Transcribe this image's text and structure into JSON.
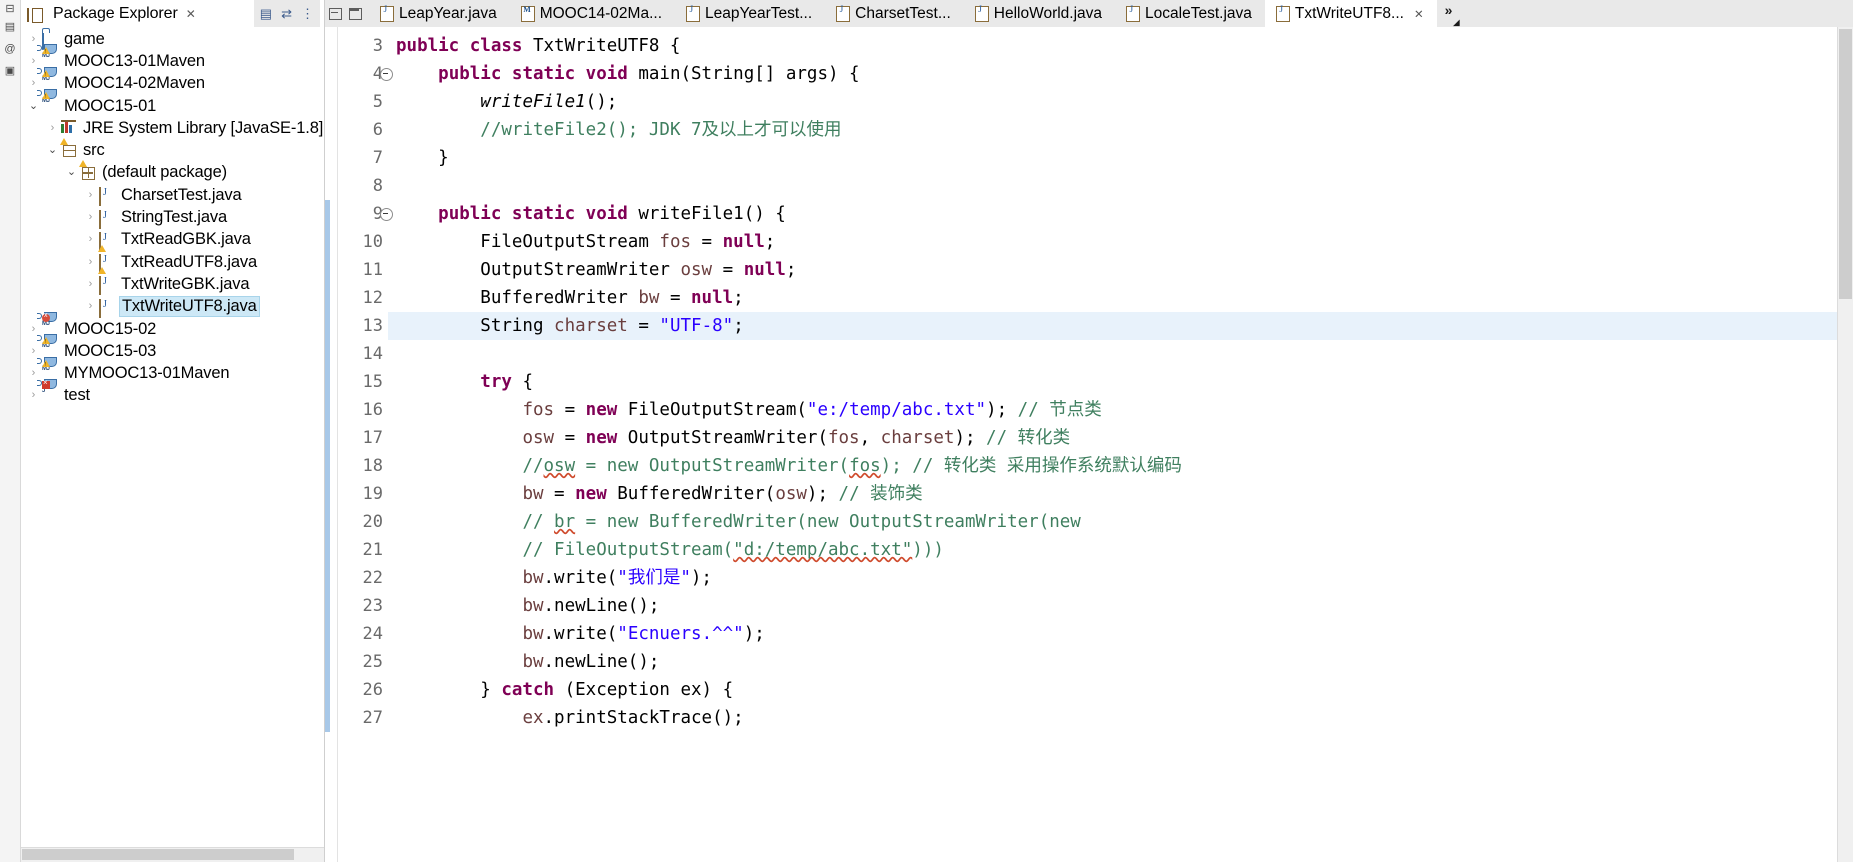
{
  "rail": {
    "icons": [
      "restore-view-icon",
      "package-explorer-icon",
      "annotations-icon",
      "snippets-icon"
    ]
  },
  "explorer": {
    "tab_title": "Package Explorer",
    "tab_close": "✕",
    "toolbar": [
      "collapse-all-icon",
      "link-with-editor-icon",
      "view-menu-icon"
    ],
    "tree": [
      {
        "indent": 0,
        "twisty": "collapsed",
        "icon": "folder",
        "label": "game"
      },
      {
        "indent": 0,
        "twisty": "collapsed",
        "icon": "project-warn",
        "label": "MOOC13-01Maven"
      },
      {
        "indent": 0,
        "twisty": "collapsed",
        "icon": "project-warn",
        "label": "MOOC14-02Maven"
      },
      {
        "indent": 0,
        "twisty": "expanded",
        "icon": "project-warn",
        "label": "MOOC15-01"
      },
      {
        "indent": 1,
        "twisty": "collapsed",
        "icon": "library",
        "label": "JRE System Library [JavaSE-1.8]"
      },
      {
        "indent": 1,
        "twisty": "expanded",
        "icon": "source-folder",
        "label": "src"
      },
      {
        "indent": 2,
        "twisty": "expanded",
        "icon": "package",
        "label": "(default package)"
      },
      {
        "indent": 3,
        "twisty": "collapsed",
        "icon": "java-file",
        "label": "CharsetTest.java"
      },
      {
        "indent": 3,
        "twisty": "collapsed",
        "icon": "java-file",
        "label": "StringTest.java"
      },
      {
        "indent": 3,
        "twisty": "collapsed",
        "icon": "java-file-warn",
        "label": "TxtReadGBK.java"
      },
      {
        "indent": 3,
        "twisty": "collapsed",
        "icon": "java-file-warn",
        "label": "TxtReadUTF8.java"
      },
      {
        "indent": 3,
        "twisty": "collapsed",
        "icon": "java-file",
        "label": "TxtWriteGBK.java"
      },
      {
        "indent": 3,
        "twisty": "collapsed",
        "icon": "java-file",
        "label": "TxtWriteUTF8.java",
        "selected": true
      },
      {
        "indent": 0,
        "twisty": "collapsed",
        "icon": "project-err",
        "label": "MOOC15-02"
      },
      {
        "indent": 0,
        "twisty": "collapsed",
        "icon": "project-warn",
        "label": "MOOC15-03"
      },
      {
        "indent": 0,
        "twisty": "collapsed",
        "icon": "project-warn",
        "label": "MYMOOC13-01Maven"
      },
      {
        "indent": 0,
        "twisty": "collapsed",
        "icon": "project-err2",
        "label": "test"
      }
    ]
  },
  "editor": {
    "window_buttons": [
      "minimize-icon",
      "maximize-icon"
    ],
    "tabs": [
      {
        "label": "LeapYear.java",
        "icon": "java-file-icon",
        "active": false
      },
      {
        "label": "MOOC14-02Ma...",
        "icon": "maven-file-icon",
        "active": false
      },
      {
        "label": "LeapYearTest...",
        "icon": "java-file-icon",
        "active": false
      },
      {
        "label": "CharsetTest...",
        "icon": "java-file-icon",
        "active": false
      },
      {
        "label": "HelloWorld.java",
        "icon": "java-file-icon",
        "active": false
      },
      {
        "label": "LocaleTest.java",
        "icon": "java-file-icon",
        "active": false
      },
      {
        "label": "TxtWriteUTF8...",
        "icon": "java-file-icon",
        "active": true,
        "close": "✕"
      }
    ],
    "more_tabs_chevron": "»",
    "first_line_number": 3,
    "highlighted_line": 13,
    "lines": [
      {
        "n": 3,
        "fold": false,
        "segments": [
          {
            "t": "k",
            "v": "public class "
          },
          {
            "t": "t",
            "v": "TxtWriteUTF8 {"
          }
        ]
      },
      {
        "n": 4,
        "fold": true,
        "segments": [
          {
            "t": "t",
            "v": "    "
          },
          {
            "t": "k",
            "v": "public static void "
          },
          {
            "t": "t",
            "v": "main(String[] args) {"
          }
        ]
      },
      {
        "n": 5,
        "fold": false,
        "segments": [
          {
            "t": "t",
            "v": "        "
          },
          {
            "t": "it",
            "v": "writeFile1"
          },
          {
            "t": "t",
            "v": "();"
          }
        ]
      },
      {
        "n": 6,
        "fold": false,
        "segments": [
          {
            "t": "t",
            "v": "        "
          },
          {
            "t": "c",
            "v": "//writeFile2(); JDK 7及以上才可以使用"
          }
        ]
      },
      {
        "n": 7,
        "fold": false,
        "segments": [
          {
            "t": "t",
            "v": "    }"
          }
        ]
      },
      {
        "n": 8,
        "fold": false,
        "segments": [
          {
            "t": "t",
            "v": ""
          }
        ]
      },
      {
        "n": 9,
        "fold": true,
        "segments": [
          {
            "t": "t",
            "v": "    "
          },
          {
            "t": "k",
            "v": "public static void "
          },
          {
            "t": "t",
            "v": "writeFile1() {"
          }
        ]
      },
      {
        "n": 10,
        "fold": false,
        "segments": [
          {
            "t": "t",
            "v": "        FileOutputStream "
          },
          {
            "t": "f",
            "v": "fos"
          },
          {
            "t": "t",
            "v": " = "
          },
          {
            "t": "k",
            "v": "null"
          },
          {
            "t": "t",
            "v": ";"
          }
        ]
      },
      {
        "n": 11,
        "fold": false,
        "segments": [
          {
            "t": "t",
            "v": "        OutputStreamWriter "
          },
          {
            "t": "f",
            "v": "osw"
          },
          {
            "t": "t",
            "v": " = "
          },
          {
            "t": "k",
            "v": "null"
          },
          {
            "t": "t",
            "v": ";"
          }
        ]
      },
      {
        "n": 12,
        "fold": false,
        "segments": [
          {
            "t": "t",
            "v": "        BufferedWriter "
          },
          {
            "t": "f",
            "v": "bw"
          },
          {
            "t": "t",
            "v": " = "
          },
          {
            "t": "k",
            "v": "null"
          },
          {
            "t": "t",
            "v": ";"
          }
        ]
      },
      {
        "n": 13,
        "fold": false,
        "highlight": true,
        "segments": [
          {
            "t": "t",
            "v": "        String "
          },
          {
            "t": "f",
            "v": "charset"
          },
          {
            "t": "t",
            "v": " = "
          },
          {
            "t": "s",
            "v": "\"UTF-8\""
          },
          {
            "t": "t",
            "v": ";"
          }
        ]
      },
      {
        "n": 14,
        "fold": false,
        "segments": [
          {
            "t": "t",
            "v": ""
          }
        ]
      },
      {
        "n": 15,
        "fold": false,
        "segments": [
          {
            "t": "t",
            "v": "        "
          },
          {
            "t": "k",
            "v": "try"
          },
          {
            "t": "t",
            "v": " {"
          }
        ]
      },
      {
        "n": 16,
        "fold": false,
        "segments": [
          {
            "t": "t",
            "v": "            "
          },
          {
            "t": "f",
            "v": "fos"
          },
          {
            "t": "t",
            "v": " = "
          },
          {
            "t": "k",
            "v": "new"
          },
          {
            "t": "t",
            "v": " FileOutputStream("
          },
          {
            "t": "s",
            "v": "\"e:/temp/abc.txt\""
          },
          {
            "t": "t",
            "v": "); "
          },
          {
            "t": "c",
            "v": "// 节点类"
          }
        ]
      },
      {
        "n": 17,
        "fold": false,
        "segments": [
          {
            "t": "t",
            "v": "            "
          },
          {
            "t": "f",
            "v": "osw"
          },
          {
            "t": "t",
            "v": " = "
          },
          {
            "t": "k",
            "v": "new"
          },
          {
            "t": "t",
            "v": " OutputStreamWriter("
          },
          {
            "t": "f",
            "v": "fos"
          },
          {
            "t": "t",
            "v": ", "
          },
          {
            "t": "f",
            "v": "charset"
          },
          {
            "t": "t",
            "v": "); "
          },
          {
            "t": "c",
            "v": "// 转化类"
          }
        ]
      },
      {
        "n": 18,
        "fold": false,
        "segments": [
          {
            "t": "t",
            "v": "            "
          },
          {
            "t": "c",
            "v": "//"
          },
          {
            "t": "c sp",
            "v": "osw"
          },
          {
            "t": "c",
            "v": " = new OutputStreamWriter("
          },
          {
            "t": "c sp",
            "v": "fos"
          },
          {
            "t": "c",
            "v": "); // 转化类 采用操作系统默认编码"
          }
        ]
      },
      {
        "n": 19,
        "fold": false,
        "segments": [
          {
            "t": "t",
            "v": "            "
          },
          {
            "t": "f",
            "v": "bw"
          },
          {
            "t": "t",
            "v": " = "
          },
          {
            "t": "k",
            "v": "new"
          },
          {
            "t": "t",
            "v": " BufferedWriter("
          },
          {
            "t": "f",
            "v": "osw"
          },
          {
            "t": "t",
            "v": "); "
          },
          {
            "t": "c",
            "v": "// 装饰类"
          }
        ]
      },
      {
        "n": 20,
        "fold": false,
        "segments": [
          {
            "t": "t",
            "v": "            "
          },
          {
            "t": "c",
            "v": "// "
          },
          {
            "t": "c sp",
            "v": "br"
          },
          {
            "t": "c",
            "v": " = new BufferedWriter(new OutputStreamWriter(new"
          }
        ]
      },
      {
        "n": 21,
        "fold": false,
        "segments": [
          {
            "t": "t",
            "v": "            "
          },
          {
            "t": "c",
            "v": "// FileOutputStream("
          },
          {
            "t": "c sp",
            "v": "\"d:/temp/abc.txt\""
          },
          {
            "t": "c",
            "v": ")))"
          }
        ]
      },
      {
        "n": 22,
        "fold": false,
        "segments": [
          {
            "t": "t",
            "v": "            "
          },
          {
            "t": "f",
            "v": "bw"
          },
          {
            "t": "t",
            "v": ".write("
          },
          {
            "t": "s",
            "v": "\"我们是\""
          },
          {
            "t": "t",
            "v": ");"
          }
        ]
      },
      {
        "n": 23,
        "fold": false,
        "segments": [
          {
            "t": "t",
            "v": "            "
          },
          {
            "t": "f",
            "v": "bw"
          },
          {
            "t": "t",
            "v": ".newLine();"
          }
        ]
      },
      {
        "n": 24,
        "fold": false,
        "segments": [
          {
            "t": "t",
            "v": "            "
          },
          {
            "t": "f",
            "v": "bw"
          },
          {
            "t": "t",
            "v": ".write("
          },
          {
            "t": "s",
            "v": "\"Ecnuers.^^\""
          },
          {
            "t": "t",
            "v": ");"
          }
        ]
      },
      {
        "n": 25,
        "fold": false,
        "segments": [
          {
            "t": "t",
            "v": "            "
          },
          {
            "t": "f",
            "v": "bw"
          },
          {
            "t": "t",
            "v": ".newLine();"
          }
        ]
      },
      {
        "n": 26,
        "fold": false,
        "segments": [
          {
            "t": "t",
            "v": "        } "
          },
          {
            "t": "k",
            "v": "catch"
          },
          {
            "t": "t",
            "v": " (Exception ex) {"
          }
        ]
      },
      {
        "n": 27,
        "fold": false,
        "segments": [
          {
            "t": "t",
            "v": "            "
          },
          {
            "t": "f",
            "v": "ex"
          },
          {
            "t": "t",
            "v": ".printStackTrace();"
          }
        ]
      }
    ]
  },
  "colors": {
    "keyword": "#7f0055",
    "string": "#2a00ff",
    "comment": "#3f7f5f",
    "field": "#6a3e3e",
    "selection": "#cde8f6",
    "line_highlight": "#e8f2fb",
    "tabbar": "#e9e9e9"
  }
}
